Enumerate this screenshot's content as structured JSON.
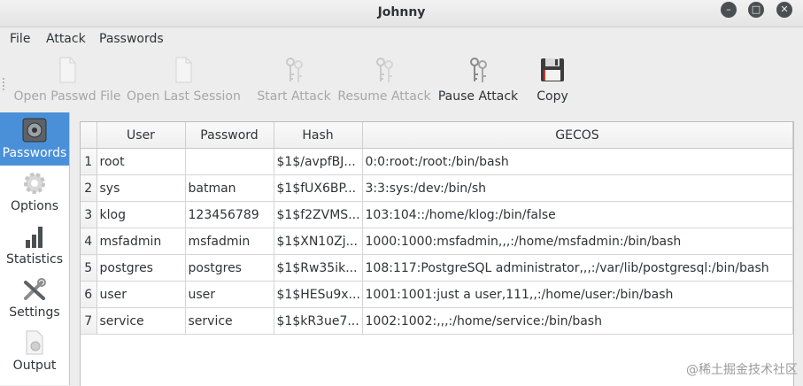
{
  "window": {
    "title": "Johnny"
  },
  "menu": [
    "File",
    "Attack",
    "Passwords"
  ],
  "toolbar": {
    "items": [
      {
        "label": "Open Passwd File",
        "icon": "file-icon",
        "enabled": false
      },
      {
        "label": "Open Last Session",
        "icon": "file-icon",
        "enabled": false
      },
      {
        "label": "Start Attack",
        "icon": "keys-icon",
        "enabled": false
      },
      {
        "label": "Resume Attack",
        "icon": "keys-icon",
        "enabled": false
      },
      {
        "label": "Pause Attack",
        "icon": "keys-icon",
        "enabled": true
      },
      {
        "label": "Copy",
        "icon": "floppy-disk-icon",
        "enabled": true
      }
    ]
  },
  "sidebar": {
    "active": "Passwords",
    "items": [
      {
        "label": "Passwords",
        "icon": "safe-icon"
      },
      {
        "label": "Options",
        "icon": "gear-icon"
      },
      {
        "label": "Statistics",
        "icon": "bar-chart-icon"
      },
      {
        "label": "Settings",
        "icon": "tools-icon"
      },
      {
        "label": "Output",
        "icon": "document-gear-icon"
      }
    ]
  },
  "table": {
    "columns": [
      "User",
      "Password",
      "Hash",
      "GECOS"
    ],
    "rows": [
      {
        "n": "1",
        "user": "root",
        "password": "",
        "hash": "$1$/avpfBJ...",
        "gecos": "0:0:root:/root:/bin/bash"
      },
      {
        "n": "2",
        "user": "sys",
        "password": "batman",
        "hash": "$1$fUX6BP...",
        "gecos": "3:3:sys:/dev:/bin/sh"
      },
      {
        "n": "3",
        "user": "klog",
        "password": "123456789",
        "hash": "$1$f2ZVMS...",
        "gecos": "103:104::/home/klog:/bin/false"
      },
      {
        "n": "4",
        "user": "msfadmin",
        "password": "msfadmin",
        "hash": "$1$XN10Zj...",
        "gecos": "1000:1000:msfadmin,,,:/home/msfadmin:/bin/bash"
      },
      {
        "n": "5",
        "user": "postgres",
        "password": "postgres",
        "hash": "$1$Rw35ik...",
        "gecos": "108:117:PostgreSQL administrator,,,:/var/lib/postgresql:/bin/bash"
      },
      {
        "n": "6",
        "user": "user",
        "password": "user",
        "hash": "$1$HESu9x...",
        "gecos": "1001:1001:just a user,111,,:/home/user:/bin/bash"
      },
      {
        "n": "7",
        "user": "service",
        "password": "service",
        "hash": "$1$kR3ue7...",
        "gecos": "1002:1002:,,,:/home/service:/bin/bash"
      }
    ]
  },
  "watermark": "@稀土掘金技术社区",
  "colors": {
    "accent": "#4a90d9",
    "disabled_text": "#a7a7a7"
  }
}
